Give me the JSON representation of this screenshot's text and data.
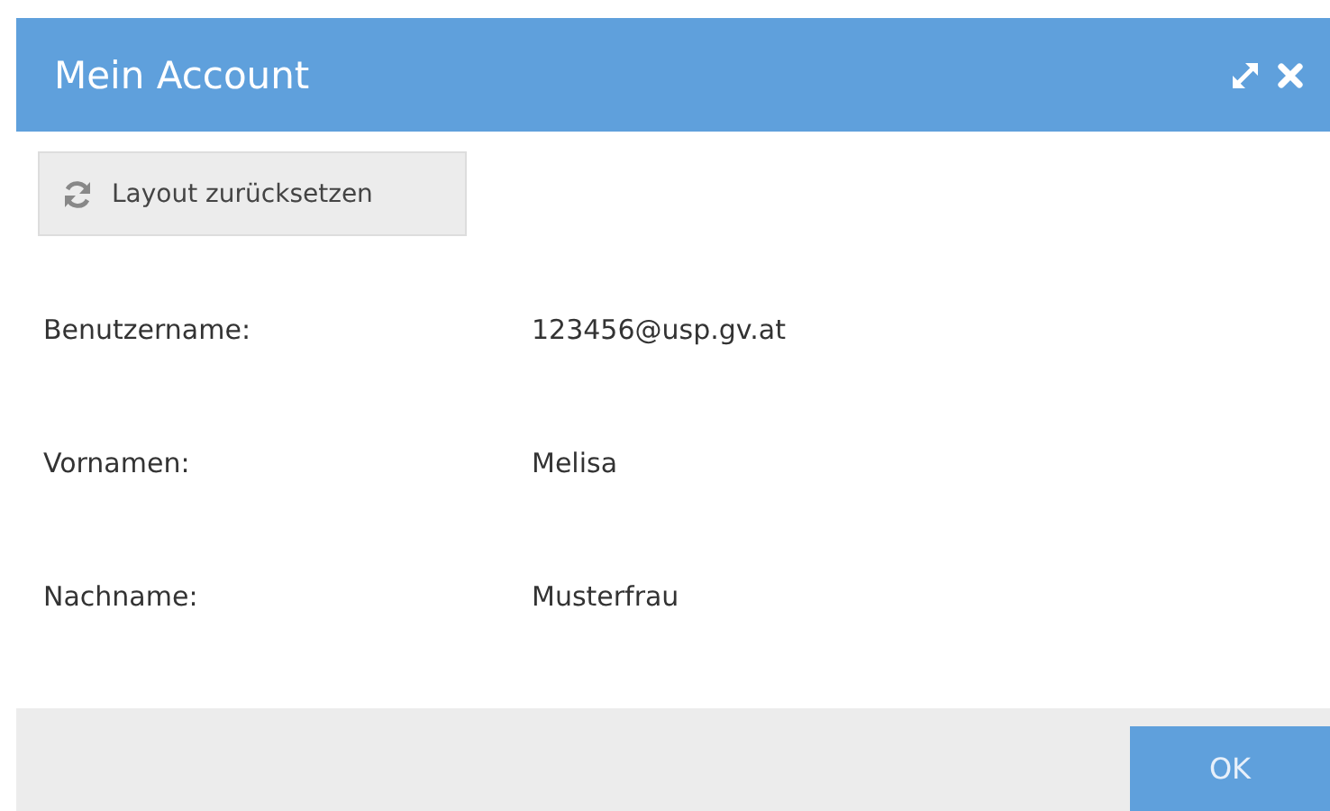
{
  "window": {
    "title": "Mein Account"
  },
  "toolbar": {
    "reset_button": "Layout zurücksetzen"
  },
  "fields": [
    {
      "label": "Benutzername:",
      "value": "123456@usp.gv.at"
    },
    {
      "label": "Vornamen:",
      "value": "Melisa"
    },
    {
      "label": "Nachname:",
      "value": "Musterfrau"
    }
  ],
  "buttons": [
    "OK"
  ]
}
